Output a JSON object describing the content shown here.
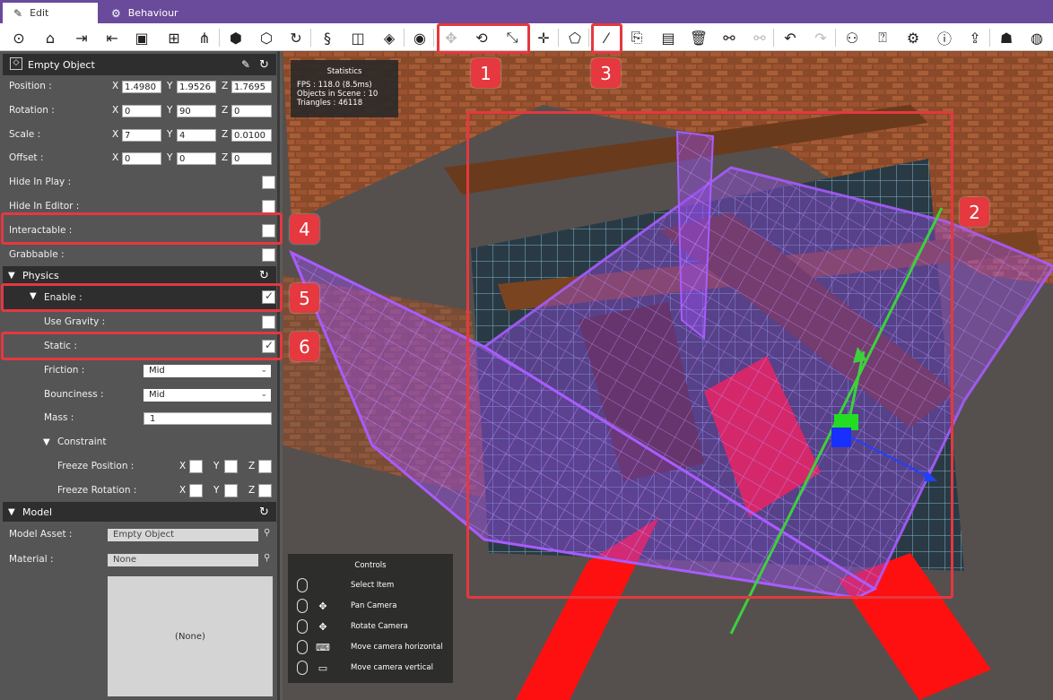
{
  "tabs": [
    {
      "label": "Edit",
      "icon": "edit-icon"
    },
    {
      "label": "Behaviour",
      "icon": "gear-icon"
    }
  ],
  "toolbar": {
    "icons": [
      "play-icon",
      "home-icon",
      "import-icon",
      "export-icon",
      "save-icon",
      "save-as-icon",
      "hierarchy-icon",
      "cube-icon",
      "multi-cube-icon",
      "rotate-object-icon",
      "script-icon",
      "cube-list-icon",
      "cube-add-icon",
      "eye-icon",
      "move-icon",
      "rotate-icon",
      "scale-icon",
      "move-axis-icon",
      "rotate-cube-icon",
      "edit-tool-icon",
      "copy-icon",
      "paste-icon",
      "delete-icon",
      "link-icon",
      "unlink-icon",
      "undo-icon",
      "redo-icon",
      "share-icon",
      "mouse-help-icon",
      "settings-icon",
      "info-icon",
      "upload-icon",
      "users-icon",
      "logo-icon"
    ]
  },
  "object": {
    "title": "Empty Object",
    "position": {
      "label": "Position :",
      "x": "1.4980",
      "y": "1.9526",
      "z": "1.7695"
    },
    "rotation": {
      "label": "Rotation :",
      "x": "0",
      "y": "90",
      "z": "0"
    },
    "scale": {
      "label": "Scale :",
      "x": "7",
      "y": "4",
      "z": "0.0100"
    },
    "offset": {
      "label": "Offset :",
      "x": "0",
      "y": "0",
      "z": "0"
    },
    "hide_in_play": {
      "label": "Hide In Play :",
      "checked": false
    },
    "hide_in_editor": {
      "label": "Hide In Editor :",
      "checked": false
    },
    "interactable": {
      "label": "Interactable :",
      "checked": false
    },
    "grabbable": {
      "label": "Grabbable :",
      "checked": false
    }
  },
  "axis_labels": {
    "x": "X",
    "y": "Y",
    "z": "Z"
  },
  "physics": {
    "title": "Physics",
    "enable": {
      "label": "Enable :",
      "checked": true
    },
    "use_gravity": {
      "label": "Use Gravity :",
      "checked": false
    },
    "static": {
      "label": "Static :",
      "checked": true
    },
    "friction": {
      "label": "Friction :",
      "value": "Mid"
    },
    "bounciness": {
      "label": "Bounciness :",
      "value": "Mid"
    },
    "mass": {
      "label": "Mass :",
      "value": "1"
    },
    "constraint": {
      "title": "Constraint",
      "freeze_position": {
        "label": "Freeze Position :"
      },
      "freeze_rotation": {
        "label": "Freeze Rotation :"
      }
    }
  },
  "model": {
    "title": "Model",
    "asset": {
      "label": "Model Asset :",
      "value": "Empty Object"
    },
    "material": {
      "label": "Material :",
      "value": "None"
    },
    "preview": "(None)"
  },
  "stats": {
    "title": "Statistics",
    "fps": "FPS : 118.0 (8.5ms)",
    "objects": "Objects in Scene : 10",
    "triangles": "Triangles : 46118"
  },
  "controls": {
    "title": "Controls",
    "items": [
      "Select Item",
      "Pan Camera",
      "Rotate Camera",
      "Move camera horizontal",
      "Move camera vertical"
    ]
  },
  "annotations": [
    "1",
    "2",
    "3",
    "4",
    "5",
    "6"
  ],
  "colors": {
    "accent": "#6a4a9a",
    "highlight": "#e5383f",
    "selection": "#9a4cf0",
    "gizmo_green": "#3cd13c",
    "gizmo_blue": "#2040ff",
    "marker_red": "#ff1010"
  }
}
